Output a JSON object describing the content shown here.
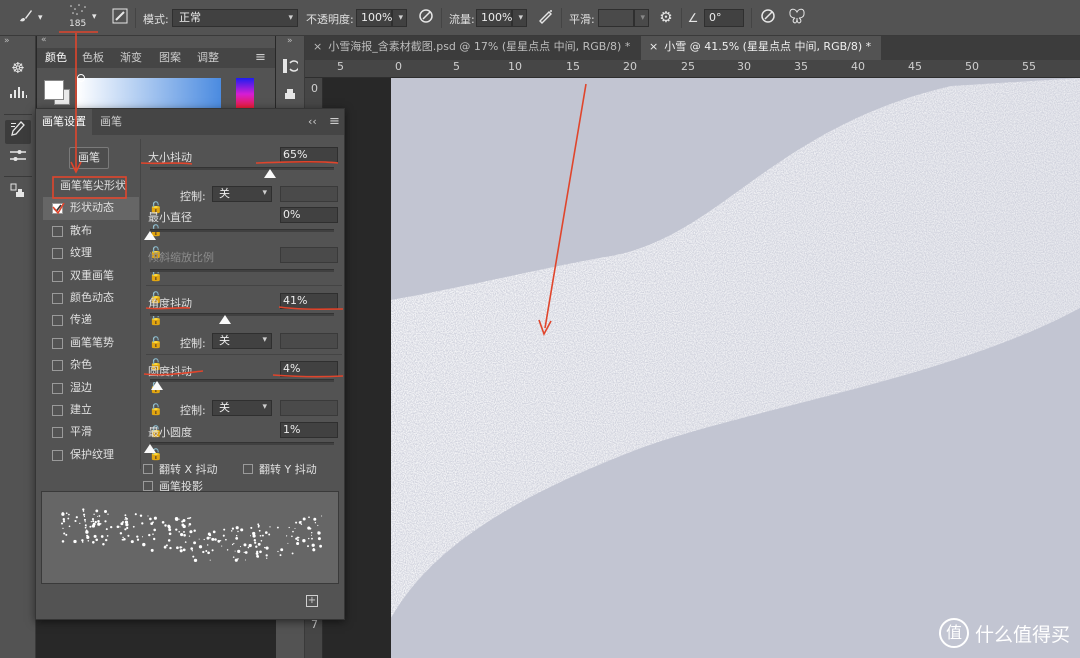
{
  "options_bar": {
    "brush_size": "185",
    "mode_label": "模式:",
    "mode_value": "正常",
    "opacity_label": "不透明度:",
    "opacity_value": "100%",
    "flow_label": "流量:",
    "flow_value": "100%",
    "smoothing_label": "平滑:",
    "smoothing_value": "",
    "angle_value": "0°"
  },
  "color_panel": {
    "tabs": [
      "颜色",
      "色板",
      "渐变",
      "图案",
      "调整"
    ]
  },
  "documents": {
    "tabs": [
      {
        "title": "小雪海报_含素材截图.psd @ 17% (星星点点 中间, RGB/8) *"
      },
      {
        "title": "小雪 @ 41.5% (星星点点 中间, RGB/8) *"
      }
    ]
  },
  "ruler": {
    "h_ticks": [
      "5",
      "0",
      "5",
      "10",
      "15",
      "20",
      "25",
      "30",
      "35",
      "40",
      "45",
      "50",
      "55"
    ],
    "v_ticks": [
      "0",
      "7"
    ]
  },
  "brush_panel": {
    "tabs": [
      "画笔设置",
      "画笔"
    ],
    "brush_button": "画笔",
    "options": [
      {
        "label": "画笔笔尖形状",
        "checkbox": false,
        "lock": false
      },
      {
        "label": "形状动态",
        "checkbox": true,
        "checked": true,
        "lock": true
      },
      {
        "label": "散布",
        "checkbox": true,
        "checked": false,
        "lock": true
      },
      {
        "label": "纹理",
        "checkbox": true,
        "checked": false,
        "lock": true
      },
      {
        "label": "双重画笔",
        "checkbox": true,
        "checked": false,
        "lock": true
      },
      {
        "label": "颜色动态",
        "checkbox": true,
        "checked": false,
        "lock": true
      },
      {
        "label": "传递",
        "checkbox": true,
        "checked": false,
        "lock": true
      },
      {
        "label": "画笔笔势",
        "checkbox": true,
        "checked": false,
        "lock": true
      },
      {
        "label": "杂色",
        "checkbox": true,
        "checked": false,
        "lock": true
      },
      {
        "label": "湿边",
        "checkbox": true,
        "checked": false,
        "lock": true
      },
      {
        "label": "建立",
        "checkbox": true,
        "checked": false,
        "lock": true
      },
      {
        "label": "平滑",
        "checkbox": true,
        "checked": false,
        "lock": true
      },
      {
        "label": "保护纹理",
        "checkbox": true,
        "checked": false,
        "lock": true
      }
    ],
    "size_jitter_label": "大小抖动",
    "size_jitter_value": "65%",
    "size_jitter_fraction": 0.65,
    "control_label": "控制:",
    "control_value": "关",
    "min_diameter_label": "最小直径",
    "min_diameter_value": "0%",
    "tilt_scale_label": "倾斜缩放比例",
    "angle_jitter_label": "角度抖动",
    "angle_jitter_value": "41%",
    "angle_jitter_fraction": 0.41,
    "roundness_jitter_label": "圆度抖动",
    "roundness_jitter_value": "4%",
    "roundness_jitter_fraction": 0.04,
    "min_roundness_label": "最小圆度",
    "min_roundness_value": "1%",
    "flip_x_label": "翻转 X 抖动",
    "flip_y_label": "翻转 Y 抖动",
    "brush_projection_label": "画笔投影"
  },
  "watermark": {
    "symbol": "值",
    "text": "什么值得买"
  },
  "colors": {
    "annotation": "#e0452c",
    "canvas": "#c2c5d2",
    "panel": "#535353"
  }
}
